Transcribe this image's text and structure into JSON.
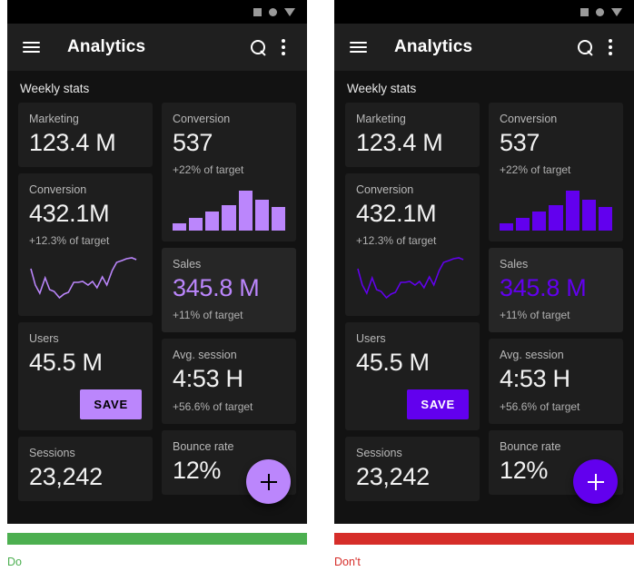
{
  "colors": {
    "do_green": "#4CAF50",
    "dont_red": "#D62D29",
    "accent_good": "#BB86FC",
    "accent_bad": "#6200EE",
    "on_accent_good": "#000000",
    "on_accent_bad": "#FFFFFF",
    "surface": "#1E1E1E",
    "surface_elevated": "#262626",
    "background": "#121212",
    "appbar": "#1F1F1F"
  },
  "statusbar": {
    "icons": [
      "square-icon",
      "circle-icon",
      "triangle-down-icon"
    ]
  },
  "appbar": {
    "menu_icon": "hamburger-menu-icon",
    "title": "Analytics",
    "search_icon": "search-icon",
    "overflow_icon": "more-vert-icon"
  },
  "content": {
    "section_title": "Weekly stats"
  },
  "cards": {
    "marketing": {
      "label": "Marketing",
      "value": "123.4 M"
    },
    "conversion_left": {
      "label": "Conversion",
      "value": "432.1M",
      "sub": "+12.3% of target"
    },
    "users": {
      "label": "Users",
      "value": "45.5 M",
      "button": "SAVE"
    },
    "sessions": {
      "label": "Sessions",
      "value": "23,242"
    },
    "conversion_right": {
      "label": "Conversion",
      "value": "537",
      "sub": "+22% of target"
    },
    "sales": {
      "label": "Sales",
      "value": "345.8 M",
      "sub": "+11% of target"
    },
    "avg_session": {
      "label": "Avg. session",
      "value": "4:53 H",
      "sub": "+56.6% of target"
    },
    "bounce_rate": {
      "label": "Bounce rate",
      "value": "12%"
    }
  },
  "fab": {
    "icon": "plus-icon"
  },
  "captions": {
    "do": "Do",
    "dont": "Don't"
  },
  "chart_data": [
    {
      "type": "bar",
      "title": "Conversion weekly bars",
      "categories": [
        "1",
        "2",
        "3",
        "4",
        "5",
        "6",
        "7"
      ],
      "values": [
        8,
        14,
        21,
        28,
        44,
        34,
        26
      ],
      "ylim": [
        0,
        48
      ],
      "xlabel": "",
      "ylabel": "",
      "grid": false,
      "legend": "none"
    },
    {
      "type": "line",
      "title": "Conversion trend sparkline",
      "x": [
        0,
        1,
        2,
        3,
        4,
        5,
        6,
        7,
        8,
        9,
        10,
        11,
        12,
        13,
        14,
        15,
        16,
        17,
        18,
        19,
        20,
        21,
        22
      ],
      "values": [
        40,
        22,
        13,
        31,
        17,
        15,
        8,
        12,
        14,
        25,
        25,
        26,
        22,
        26,
        19,
        31,
        22,
        38,
        47,
        49,
        51,
        52,
        50
      ],
      "ylim": [
        0,
        56
      ],
      "xlabel": "",
      "ylabel": "",
      "grid": false,
      "legend": "none"
    }
  ]
}
